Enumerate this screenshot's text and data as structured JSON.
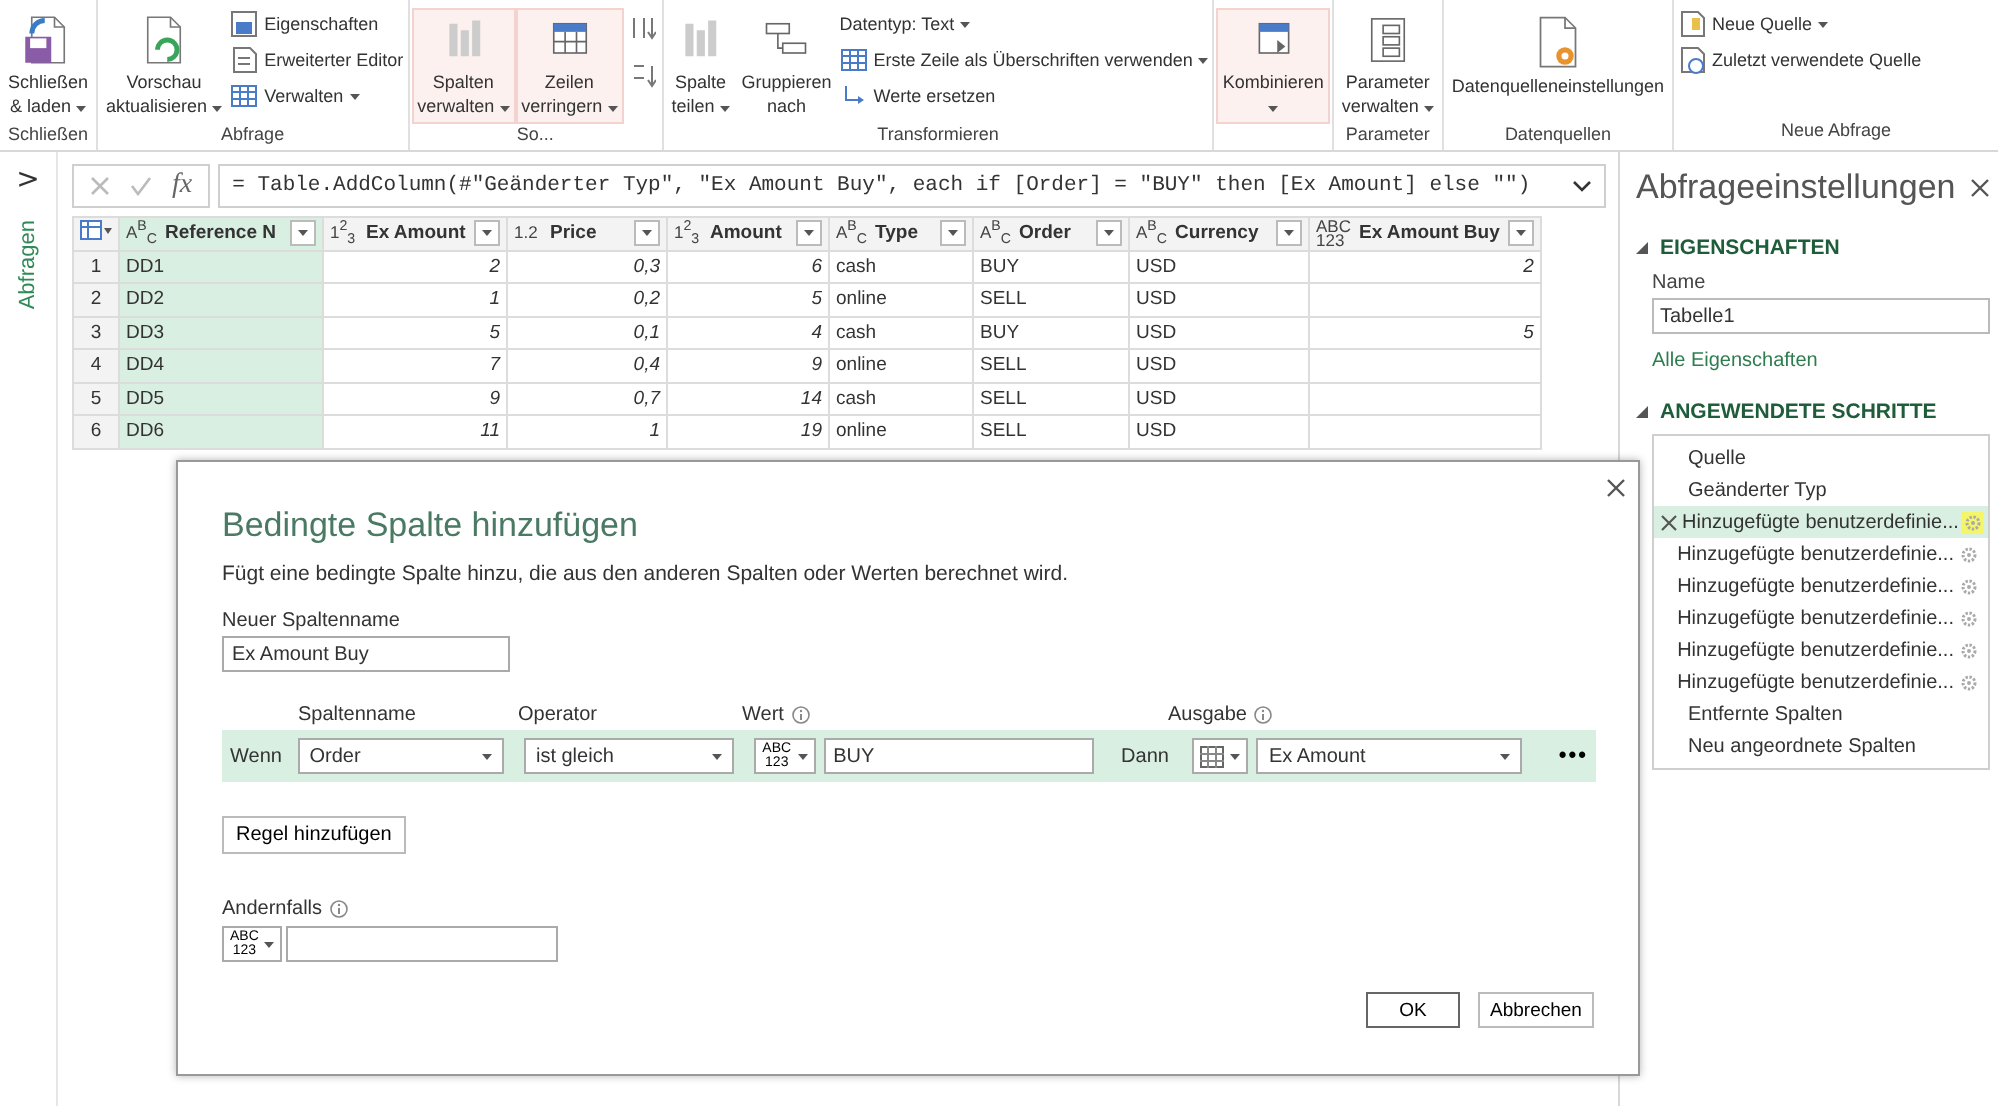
{
  "ribbon": {
    "groups": [
      {
        "label": "Schließen",
        "items": [
          {
            "kind": "large",
            "lines": [
              "Schließen",
              "& laden"
            ],
            "dropdown": true,
            "highlighted": false
          }
        ]
      },
      {
        "label": "Abfrage",
        "items": [
          {
            "kind": "large",
            "lines": [
              "Vorschau",
              "aktualisieren"
            ],
            "dropdown": true,
            "highlighted": false
          },
          {
            "kind": "stack",
            "items": [
              {
                "label": "Eigenschaften",
                "dropdown": false
              },
              {
                "label": "Erweiterter Editor",
                "dropdown": false
              },
              {
                "label": "Verwalten",
                "dropdown": true
              }
            ]
          }
        ]
      },
      {
        "label": "So...",
        "items": [
          {
            "kind": "large",
            "lines": [
              "Spalten",
              "verwalten"
            ],
            "dropdown": true,
            "highlighted": true
          },
          {
            "kind": "large",
            "lines": [
              "Zeilen",
              "verringern"
            ],
            "dropdown": true,
            "highlighted": true
          },
          {
            "kind": "stack",
            "items": [
              {
                "icon_only": true
              },
              {
                "icon_only": true
              }
            ]
          }
        ]
      },
      {
        "label": "Transformieren",
        "items": [
          {
            "kind": "large",
            "lines": [
              "Spalte",
              "teilen"
            ],
            "dropdown": true,
            "highlighted": false
          },
          {
            "kind": "large",
            "lines": [
              "Gruppieren",
              "nach"
            ],
            "dropdown": false,
            "highlighted": false
          },
          {
            "kind": "stack",
            "items": [
              {
                "label": "Datentyp: Text",
                "dropdown": true
              },
              {
                "label": "Erste Zeile als Überschriften verwenden",
                "dropdown": true
              },
              {
                "label": "Werte ersetzen",
                "dropdown": false
              }
            ]
          }
        ]
      },
      {
        "items": [
          {
            "kind": "large",
            "lines": [
              "Kombinieren"
            ],
            "dropdown": true,
            "highlighted": true
          }
        ]
      },
      {
        "label": "Parameter",
        "items": [
          {
            "kind": "large",
            "lines": [
              "Parameter",
              "verwalten"
            ],
            "dropdown": true,
            "highlighted": false
          }
        ]
      },
      {
        "label": "Datenquellen",
        "items": [
          {
            "kind": "large",
            "lines": [
              "Datenquelleneinstellungen"
            ],
            "dropdown": false,
            "highlighted": false
          }
        ]
      },
      {
        "label": "Neue Abfrage",
        "items": [
          {
            "kind": "stack",
            "items": [
              {
                "label": "Neue Quelle",
                "dropdown": true
              },
              {
                "label": "Zuletzt verwendete Quelle",
                "dropdown": false
              }
            ]
          }
        ]
      }
    ]
  },
  "nav": {
    "expand": ">",
    "label": "Abfragen"
  },
  "formula": {
    "fx": "fx",
    "text": "= Table.AddColumn(#\"Geänderter Typ\", \"Ex Amount Buy\", each if [Order] = \"BUY\" then [Ex Amount] else \"\")"
  },
  "table": {
    "columns": [
      {
        "type": "A$^{B}$$_{C}$",
        "name": "Reference N",
        "kind": "text",
        "selected": true
      },
      {
        "type": "1$^{2}$$_{3}$",
        "name": "Ex Amount",
        "kind": "number",
        "selected": false
      },
      {
        "type": "1.2",
        "name": "Price",
        "kind": "number",
        "selected": false
      },
      {
        "type": "1$^{2}$$_{3}$",
        "name": "Amount",
        "kind": "number",
        "selected": false
      },
      {
        "type": "A$^{B}$$_{C}$",
        "name": "Type",
        "kind": "text",
        "selected": false
      },
      {
        "type": "A$^{B}$$_{C}$",
        "name": "Order",
        "kind": "text",
        "selected": false
      },
      {
        "type": "A$^{B}$$_{C}$",
        "name": "Currency",
        "kind": "text",
        "selected": false
      },
      {
        "type": "ABC\n123",
        "name": "Ex Amount Buy",
        "kind": "number",
        "selected": false
      }
    ],
    "rows": [
      {
        "num": "1",
        "cells": [
          "DD1",
          "2",
          "0,3",
          "6",
          "cash",
          "BUY",
          "USD",
          "2"
        ]
      },
      {
        "num": "2",
        "cells": [
          "DD2",
          "1",
          "0,2",
          "5",
          "online",
          "SELL",
          "USD",
          null
        ]
      },
      {
        "num": "3",
        "cells": [
          "DD3",
          "5",
          "0,1",
          "4",
          "cash",
          "BUY",
          "USD",
          "5"
        ]
      },
      {
        "num": "4",
        "cells": [
          "DD4",
          "7",
          "0,4",
          "9",
          "online",
          "SELL",
          "USD",
          null
        ]
      },
      {
        "num": "5",
        "cells": [
          "DD5",
          "9",
          "0,7",
          "14",
          "cash",
          "SELL",
          "USD",
          null
        ]
      },
      {
        "num": "6",
        "cells": [
          "DD6",
          "11",
          "1",
          "19",
          "online",
          "SELL",
          "USD",
          null
        ]
      }
    ]
  },
  "settings": {
    "title": "Abfrageeinstellungen",
    "sections": [
      {
        "title": "EIGENSCHAFTEN",
        "expanded": true,
        "kind": "properties",
        "name_label": "Name",
        "name_value": "Tabelle1",
        "link": "Alle Eigenschaften"
      },
      {
        "title": "ANGEWENDETE SCHRITTE",
        "expanded": true,
        "kind": "steps",
        "steps": [
          {
            "label": "Quelle",
            "selected": false,
            "gear": false
          },
          {
            "label": "Geänderter Typ",
            "selected": false,
            "gear": false
          },
          {
            "label": "Hinzugefügte benutzerdefinie...",
            "selected": true,
            "gear": true,
            "highlighted": true
          },
          {
            "label": "Hinzugefügte benutzerdefinie...",
            "selected": false,
            "gear": true,
            "highlighted": false
          },
          {
            "label": "Hinzugefügte benutzerdefinie...",
            "selected": false,
            "gear": true,
            "highlighted": false
          },
          {
            "label": "Hinzugefügte benutzerdefinie...",
            "selected": false,
            "gear": true,
            "highlighted": false
          },
          {
            "label": "Hinzugefügte benutzerdefinie...",
            "selected": false,
            "gear": true,
            "highlighted": false
          },
          {
            "label": "Hinzugefügte benutzerdefinie...",
            "selected": false,
            "gear": true,
            "highlighted": false
          },
          {
            "label": "Entfernte Spalten",
            "selected": false,
            "gear": false
          },
          {
            "label": "Neu angeordnete Spalten",
            "selected": false,
            "gear": false
          }
        ]
      }
    ]
  },
  "dialog": {
    "title": "Bedingte Spalte hinzufügen",
    "description": "Fügt eine bedingte Spalte hinzu, die aus den anderen Spalten oder Werten berechnet wird.",
    "name_label": "Neuer Spaltenname",
    "name_value": "Ex Amount Buy",
    "headers": [
      {
        "label": "Spaltenname",
        "info": false
      },
      {
        "label": "Operator",
        "info": false
      },
      {
        "label": "Wert",
        "info": true
      },
      {
        "label": "Ausgabe",
        "info": true
      }
    ],
    "rule": {
      "if": "Wenn",
      "column": "Order",
      "operator": "ist gleich",
      "value_type": "ABC\n123",
      "value": "BUY",
      "then": "Dann",
      "output": "Ex Amount",
      "more": "•••"
    },
    "add_rule": "Regel hinzufügen",
    "else_label": "Andernfalls",
    "else_info": true,
    "else_type": "ABC\n123",
    "ok": "OK",
    "cancel": "Abbrechen"
  }
}
